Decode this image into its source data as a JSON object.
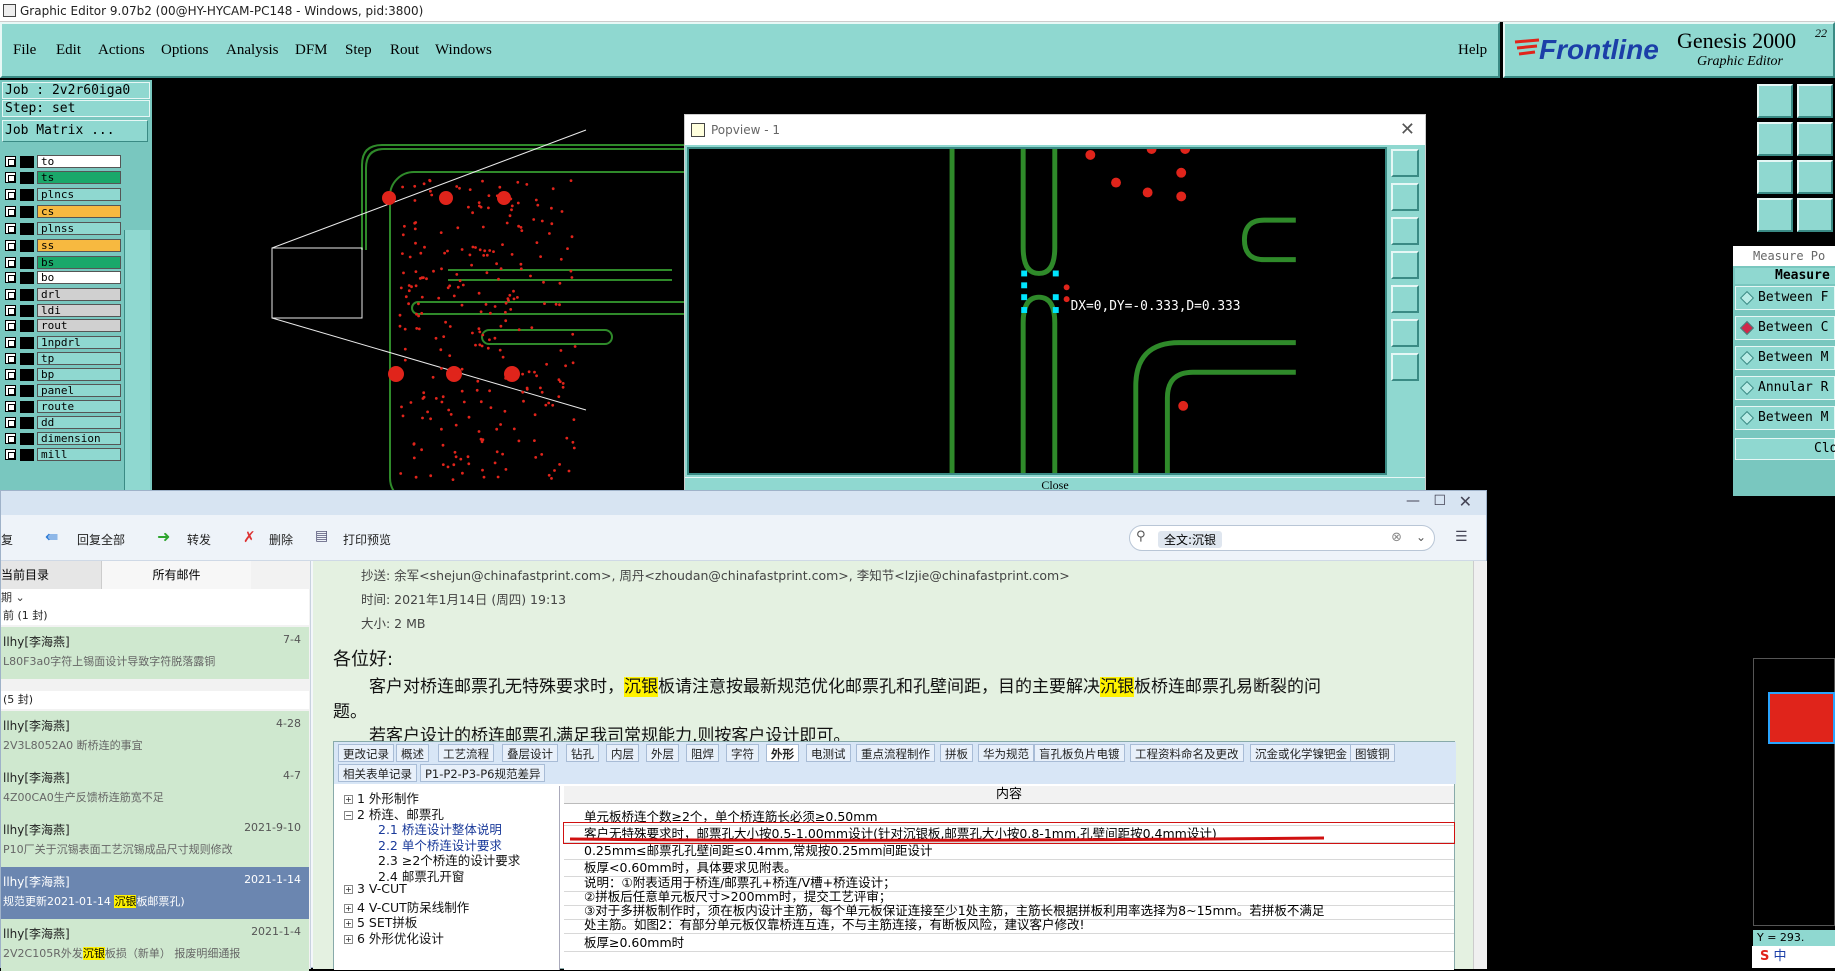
{
  "titlebar": {
    "title": "Graphic Editor 9.07b2 (00@HY-HYCAM-PC148 - Windows, pid:3800)"
  },
  "menubar": {
    "items": [
      "File",
      "Edit",
      "Actions",
      "Options",
      "Analysis",
      "DFM",
      "Step",
      "Rout",
      "Windows"
    ],
    "help": "Help"
  },
  "logo": {
    "brand": "Frontline",
    "product": "Genesis 2000",
    "subtitle": "Graphic Editor",
    "version_fragment": "22"
  },
  "left_panel": {
    "job": "Job : 2v2r60iga0",
    "step": "Step: set",
    "job_matrix": "Job Matrix ...",
    "layers": [
      {
        "name": "to",
        "color": "#ffffff"
      },
      {
        "name": "ts",
        "color": "#1aa86a"
      },
      {
        "name": "plncs",
        "color": "#8fd8d0"
      },
      {
        "name": "cs",
        "color": "#f7b940"
      },
      {
        "name": "plnss",
        "color": "#8fd8d0"
      },
      {
        "name": "ss",
        "color": "#f7b940"
      },
      {
        "name": "bs",
        "color": "#1aa86a"
      },
      {
        "name": "bo",
        "color": "#ffffff"
      },
      {
        "name": "drl",
        "color": "#d0d0d0"
      },
      {
        "name": "ldi",
        "color": "#d0d0d0"
      },
      {
        "name": "rout",
        "color": "#d0d0d0"
      },
      {
        "name": "1npdrl",
        "color": "#8fd8d0"
      },
      {
        "name": "tp",
        "color": "#8fd8d0"
      },
      {
        "name": "bp",
        "color": "#8fd8d0"
      },
      {
        "name": "panel",
        "color": "#8fd8d0"
      },
      {
        "name": "route",
        "color": "#8fd8d0"
      },
      {
        "name": "dd",
        "color": "#8fd8d0"
      },
      {
        "name": "dimension",
        "color": "#8fd8d0"
      },
      {
        "name": "mill",
        "color": "#8fd8d0"
      }
    ]
  },
  "popview": {
    "title": "Popview - 1",
    "measure_text": "DX=0,DY=-0.333,D=0.333",
    "close_label": "Close"
  },
  "measure_popup": {
    "title": "Measure Po",
    "header": "Measure",
    "options": [
      "Between F",
      "Between C",
      "Between M",
      "Annular R",
      "Between M"
    ],
    "close_label": "Clos"
  },
  "right_readout": "Y = 293.",
  "mail": {
    "toolbar": {
      "reply": "复",
      "reply_all": "回复全部",
      "forward": "转发",
      "delete": "删除",
      "print_preview": "打印预览",
      "search_value": "全文:沉银"
    },
    "folder_tabs": [
      "当前目录",
      "所有邮件"
    ],
    "sort_label": "期",
    "groups": [
      {
        "label": "前 (1 封)"
      },
      {
        "label": "(5 封)"
      }
    ],
    "messages": [
      {
        "from": "llhy[李海燕]",
        "date": "7-4",
        "subject": "L80F3a0字符上锡面设计导致字符脱落露铜"
      },
      {
        "from": "llhy[李海燕]",
        "date": "4-28",
        "subject": "2V3L8052A0 断桥连的事宜"
      },
      {
        "from": "llhy[李海燕]",
        "date": "4-7",
        "subject": "4Z00CA0生产反馈桥连筋宽不足"
      },
      {
        "from": "llhy[李海燕]",
        "date": "2021-9-10",
        "subject": "P10厂关于沉锡表面工艺沉锡成品尺寸规则修改"
      },
      {
        "from": "llhy[李海燕]",
        "date": "2021-1-14",
        "subject_pre": "规范更新2021-01-14 ",
        "subject_hl": "沉银",
        "subject_post": "板邮票孔)"
      },
      {
        "from": "llhy[李海燕]",
        "date": "2021-1-4",
        "subject_pre": "2V2C105R外发",
        "subject_hl": "沉银",
        "subject_post": "板损（新单） 报废明细通报"
      }
    ],
    "header": {
      "cc": "抄送: 余军<shejun@chinafastprint.com>, 周丹<zhoudan@chinafastprint.com>, 李知节<lzjie@chinafastprint.com>",
      "time": "时间: 2021年1月14日 (周四) 19:13",
      "size": "大小: 2 MB"
    },
    "body": {
      "greeting": "各位好:",
      "p1_a": "客户对桥连邮票孔无特殊要求时，",
      "p1_hl1": "沉银",
      "p1_b": "板请注意按最新规范优化邮票孔和孔壁间距，目的主要解决",
      "p1_hl2": "沉银",
      "p1_c": "板桥连邮票孔易断裂的问",
      "p1_d": "题。",
      "p2": "若客户设计的桥连邮票孔满足我司常规能力,则按客户设计即可。"
    },
    "doc": {
      "tabs_row1": [
        "更改记录",
        "概述",
        "工艺流程",
        "叠层设计",
        "钻孔",
        "内层",
        "外层",
        "阻焊",
        "字符",
        "外形",
        "电测试",
        "重点流程制作",
        "拼板",
        "华为规范",
        "盲孔板负片电镀",
        "工程资料命名及更改",
        "沉金或化学镍钯金",
        "图镀铜"
      ],
      "tabs_row2": [
        "相关表单记录",
        "P1-P2-P3-P6规范差异"
      ],
      "tree": [
        "1 外形制作",
        "2 桥连、邮票孔",
        "2.1 桥连设计整体说明",
        "2.2 单个桥连设计要求",
        "2.3 ≥2个桥连的设计要求",
        "2.4 邮票孔开窗",
        "3 V-CUT",
        "4 V-CUT防呆线制作",
        "5 SET拼板",
        "6 外形优化设计"
      ],
      "column_header": "内容",
      "rows": [
        "单元板桥连个数≥2个，单个桥连筋长必须≥0.50mm",
        "客户无特殊要求时，邮票孔大小按0.5-1.00mm设计(针对沉银板,邮票孔大小按0.8-1mm,孔壁间距按0.4mm设计)",
        "0.25mm≤邮票孔孔壁间距≤0.4mm,常规按0.25mm间距设计",
        "板厚<0.60mm时，具体要求见附表。",
        "说明：①附表适用于桥连/邮票孔+桥连/V槽+桥连设计；",
        "②拼板后任意单元板尺寸>200mm时，提交工艺评审；",
        "③对于多拼板制作时，须在板内设计主筋，每个单元板保证连接至少1处主筋，主筋长根据拼板利用率选择为8~15mm。若拼板不满足",
        "处主筋。如图2：有部分单元板仅靠桥连互连，不与主筋连接，有断板风险，建议客户修改!",
        "板厚≥0.60mm时"
      ]
    }
  },
  "ime": {
    "lang": "中"
  }
}
